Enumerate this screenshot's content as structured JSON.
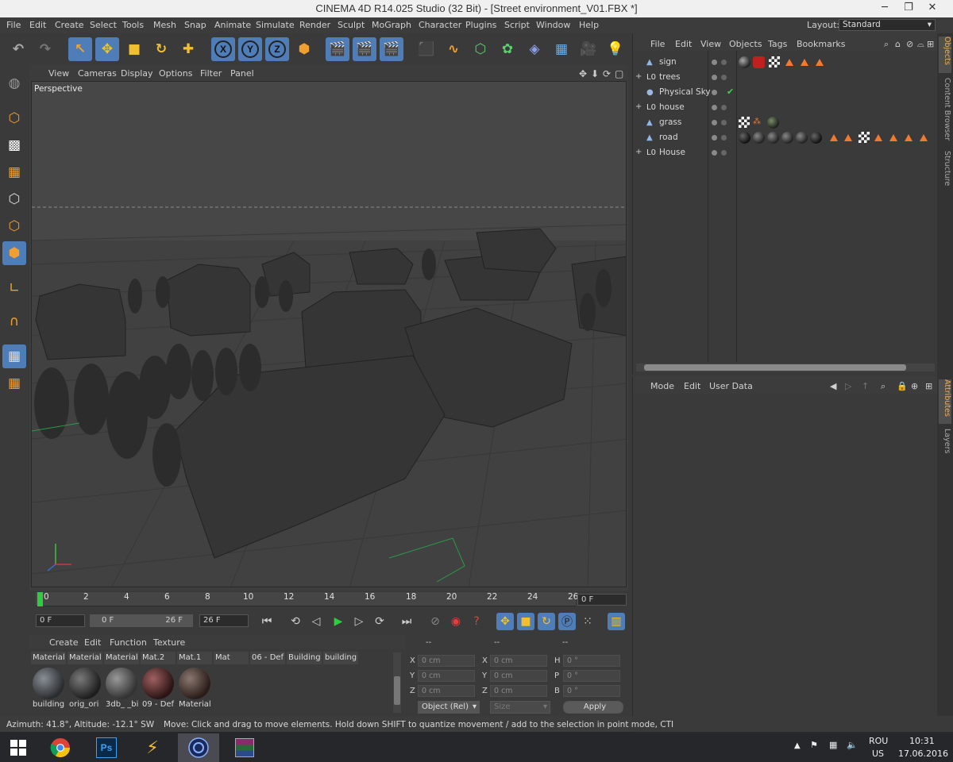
{
  "window": {
    "title": "CINEMA 4D R14.025 Studio (32 Bit) - [Street environment_V01.FBX *]",
    "min": "─",
    "max": "❐",
    "close": "✕"
  },
  "menubar": {
    "items": [
      "File",
      "Edit",
      "Create",
      "Select",
      "Tools",
      "Mesh",
      "Snap",
      "Animate",
      "Simulate",
      "Render",
      "Sculpt",
      "MoGraph",
      "Character",
      "Plugins",
      "Script",
      "Window",
      "Help"
    ],
    "layout_label": "Layout:",
    "layout_value": "Standard"
  },
  "viewport": {
    "menu": [
      "View",
      "Cameras",
      "Display",
      "Options",
      "Filter",
      "Panel"
    ],
    "label": "Perspective"
  },
  "timeline": {
    "ticks": [
      "0",
      "2",
      "4",
      "6",
      "8",
      "10",
      "12",
      "14",
      "16",
      "18",
      "20",
      "22",
      "24",
      "26"
    ],
    "current_frame_field": "0 F"
  },
  "transport": {
    "start_field": "0 F",
    "range_start": "0 F",
    "range_end": "26 F",
    "end_field": "26 F"
  },
  "materials": {
    "menu": [
      "Create",
      "Edit",
      "Function",
      "Texture"
    ],
    "names": [
      "Material",
      "Material",
      "Material",
      "Mat.2",
      "Mat.1",
      "Mat",
      "06 - Def",
      "Building",
      "building"
    ],
    "swatches": [
      {
        "caption": "building",
        "color": "#5a5f66"
      },
      {
        "caption": "orig_ori",
        "color": "#4a4a4a"
      },
      {
        "caption": "3db_ _bi",
        "color": "#6a6a6a"
      },
      {
        "caption": "09 - Def",
        "color": "#6b3a3a"
      },
      {
        "caption": "Material",
        "color": "#5b4a44"
      }
    ]
  },
  "coords": {
    "headers": [
      "--",
      "--",
      "--"
    ],
    "rows": [
      {
        "a": "X",
        "av": "0 cm",
        "b": "X",
        "bv": "0 cm",
        "c": "H",
        "cv": "0 °"
      },
      {
        "a": "Y",
        "av": "0 cm",
        "b": "Y",
        "bv": "0 cm",
        "c": "P",
        "cv": "0 °"
      },
      {
        "a": "Z",
        "av": "0 cm",
        "b": "Z",
        "bv": "0 cm",
        "c": "B",
        "cv": "0 °"
      }
    ],
    "mode": "Object (Rel)",
    "size": "Size",
    "apply": "Apply"
  },
  "status": {
    "left": "Azimuth: 41.8°, Altitude: -12.1°  SW",
    "right": "Move: Click and drag to move elements. Hold down SHIFT to quantize movement / add to the selection in point mode, CTI"
  },
  "objects": {
    "menu": [
      "File",
      "Edit",
      "View",
      "Objects",
      "Tags",
      "Bookmarks"
    ],
    "rows": [
      {
        "name": "sign",
        "icon": "▲",
        "expand": ""
      },
      {
        "name": "trees",
        "icon": "L0",
        "expand": "+"
      },
      {
        "name": "Physical Sky",
        "icon": "●",
        "expand": ""
      },
      {
        "name": "house",
        "icon": "L0",
        "expand": "+"
      },
      {
        "name": "grass",
        "icon": "▲",
        "expand": ""
      },
      {
        "name": "road",
        "icon": "▲",
        "expand": ""
      },
      {
        "name": "House",
        "icon": "L0",
        "expand": "+"
      }
    ]
  },
  "attributes": {
    "menu": [
      "Mode",
      "Edit",
      "User Data"
    ]
  },
  "side_tabs": [
    "Objects",
    "Content Browser",
    "Structure",
    "Attributes",
    "Layers"
  ],
  "taskbar": {
    "lang": "ROU",
    "lang2": "US",
    "time": "10:31",
    "date": "17.06.2016"
  },
  "colors": {
    "accent": "#4f7db8",
    "panel": "#3a3a3a",
    "viewport_bg": "#434343",
    "tag_orange": "#f07a30"
  }
}
